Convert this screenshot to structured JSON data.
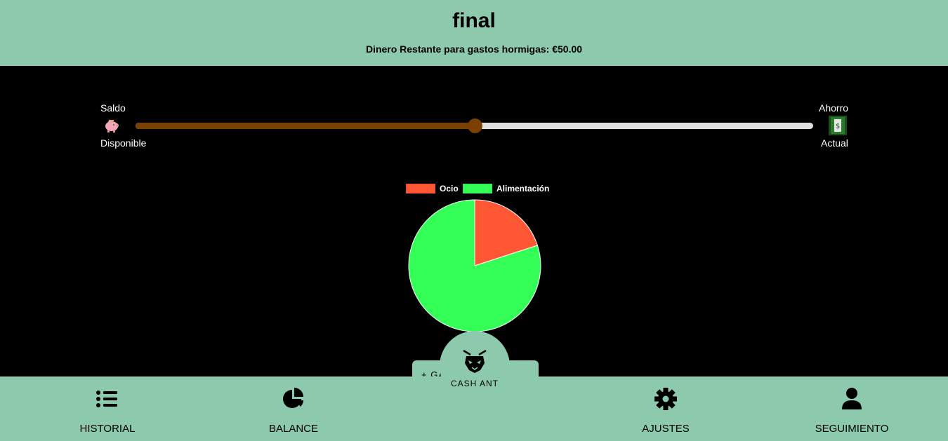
{
  "header": {
    "title": "final",
    "subtitle": "Dinero Restante para gastos hormigas: €50.00"
  },
  "balance_slider": {
    "left_label_top": "Saldo",
    "left_label_bottom": "Disponible",
    "right_label_top": "Ahorro",
    "right_label_bottom": "Actual",
    "left_icon": "piggy-bank-icon",
    "right_icon": "money-bill-icon",
    "value_fraction": 0.5,
    "fill_color": "#7a4000",
    "track_color": "#e0e0e0"
  },
  "chart_data": {
    "type": "pie",
    "title": "",
    "labels": [
      "Ocio",
      "Alimentación"
    ],
    "values": [
      20,
      80
    ],
    "colors": [
      "#ff5733",
      "#33ff57"
    ],
    "legend_position": "top"
  },
  "center_fab": {
    "label": "CASH ANT",
    "icon": "ant-logo-icon",
    "hidden_text": "+ GASTO"
  },
  "bottom_nav": {
    "items": [
      {
        "label": "HISTORIAL",
        "icon": "list-icon"
      },
      {
        "label": "BALANCE",
        "icon": "pie-chart-icon"
      },
      {
        "label": "AJUSTES",
        "icon": "gear-icon"
      },
      {
        "label": "SEGUIMIENTO",
        "icon": "user-icon"
      }
    ]
  },
  "colors": {
    "accent": "#8dc9ad",
    "background": "#000000"
  }
}
